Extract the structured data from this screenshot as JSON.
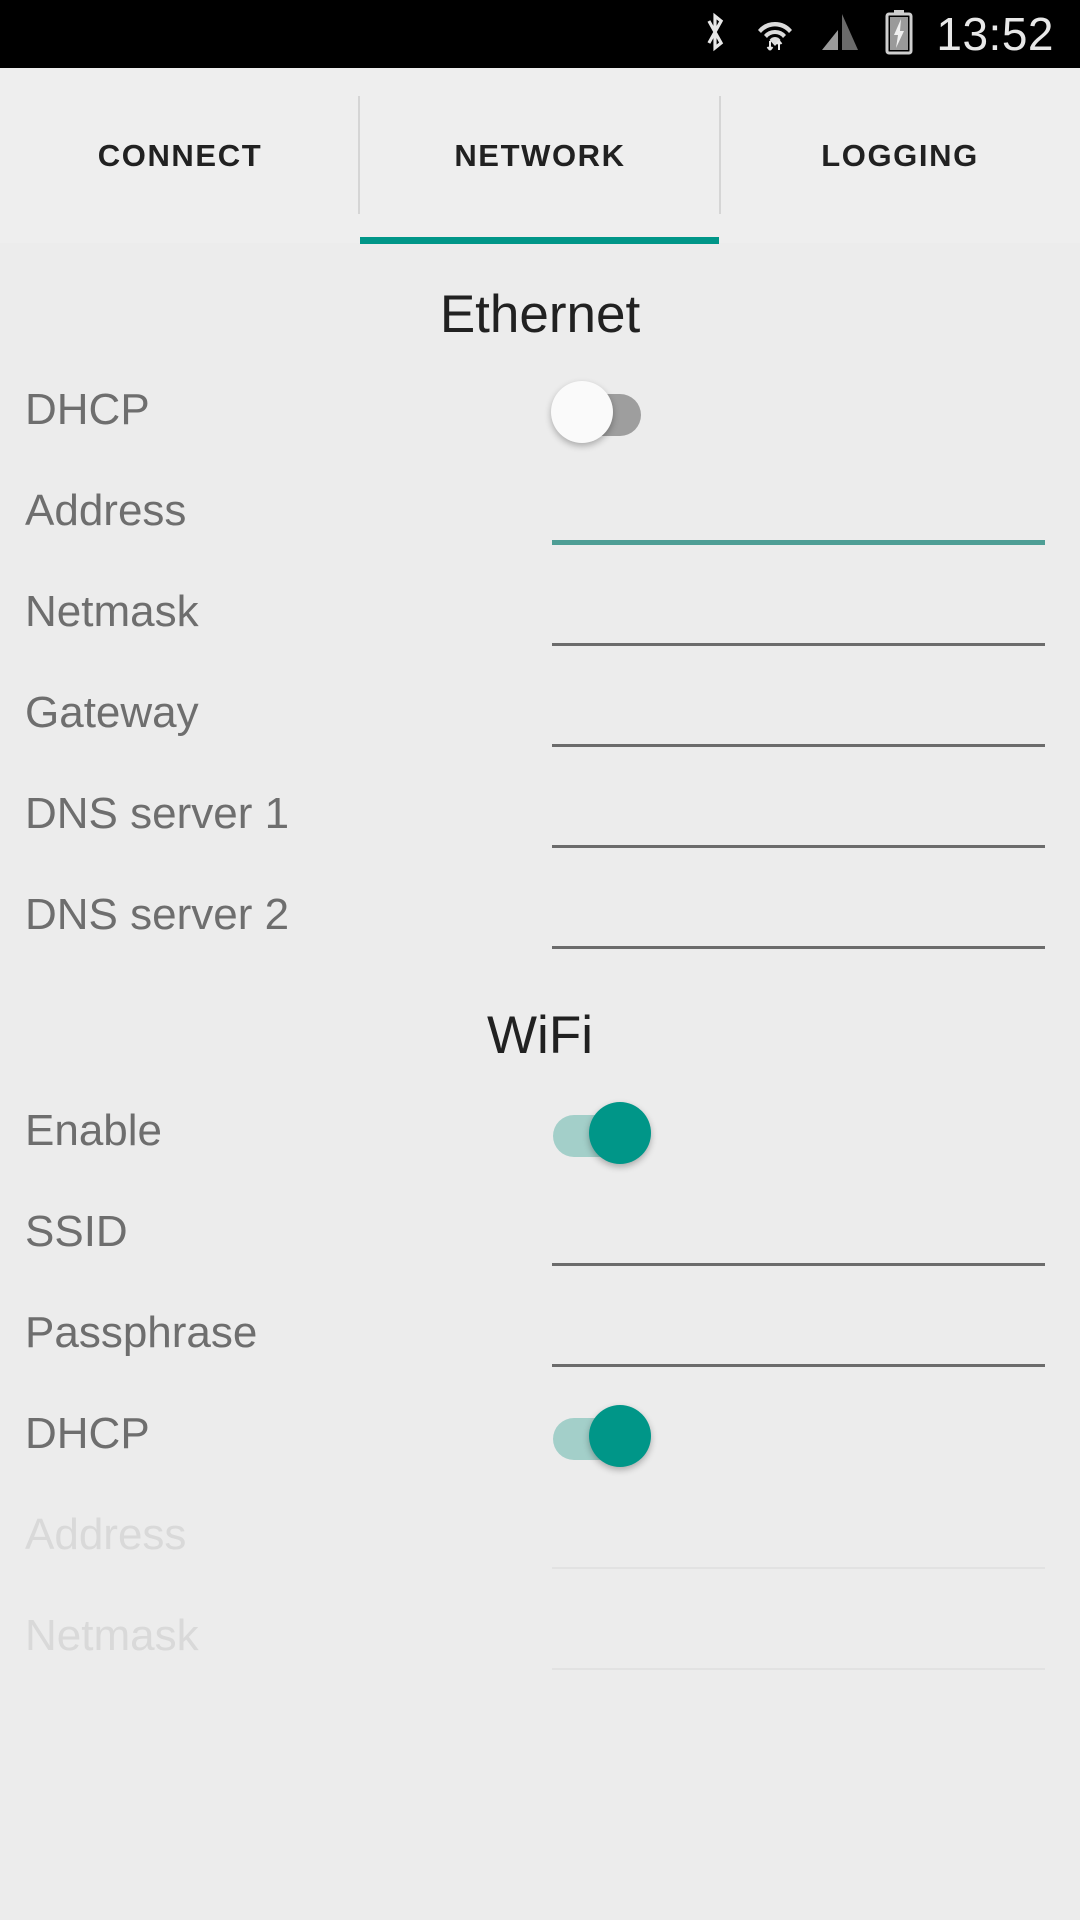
{
  "status_bar": {
    "time": "13:52",
    "icons": [
      {
        "name": "bluetooth-icon",
        "label": "Bluetooth"
      },
      {
        "name": "wifi-icon",
        "label": "WiFi with data transfer"
      },
      {
        "name": "cellular-signal-icon",
        "label": "Cellular signal"
      },
      {
        "name": "battery-charging-icon",
        "label": "Battery charging"
      }
    ]
  },
  "tabs": [
    {
      "label": "CONNECT",
      "active": false
    },
    {
      "label": "NETWORK",
      "active": true
    },
    {
      "label": "LOGGING",
      "active": false
    }
  ],
  "accent_color": "#009688",
  "background_color": "#ececec",
  "sections": [
    {
      "title": "Ethernet",
      "rows": [
        {
          "label": "DHCP",
          "type": "switch",
          "state": "off"
        },
        {
          "label": "Address",
          "type": "text",
          "value": "",
          "placeholder": "",
          "focused": true,
          "disabled": false
        },
        {
          "label": "Netmask",
          "type": "text",
          "value": "",
          "placeholder": "",
          "focused": false,
          "disabled": false
        },
        {
          "label": "Gateway",
          "type": "text",
          "value": "",
          "placeholder": "",
          "focused": false,
          "disabled": false
        },
        {
          "label": "DNS server 1",
          "type": "text",
          "value": "",
          "placeholder": "",
          "focused": false,
          "disabled": false
        },
        {
          "label": "DNS server 2",
          "type": "text",
          "value": "",
          "placeholder": "",
          "focused": false,
          "disabled": false
        }
      ]
    },
    {
      "title": "WiFi",
      "rows": [
        {
          "label": "Enable",
          "type": "switch",
          "state": "on"
        },
        {
          "label": "SSID",
          "type": "text",
          "value": "",
          "placeholder": "",
          "focused": false,
          "disabled": false
        },
        {
          "label": "Passphrase",
          "type": "text",
          "value": "",
          "placeholder": "",
          "focused": false,
          "disabled": false
        },
        {
          "label": "DHCP",
          "type": "switch",
          "state": "on"
        },
        {
          "label": "Address",
          "type": "text",
          "value": "",
          "placeholder": "",
          "focused": false,
          "disabled": true
        },
        {
          "label": "Netmask",
          "type": "text",
          "value": "",
          "placeholder": "",
          "focused": false,
          "disabled": true
        }
      ]
    }
  ]
}
